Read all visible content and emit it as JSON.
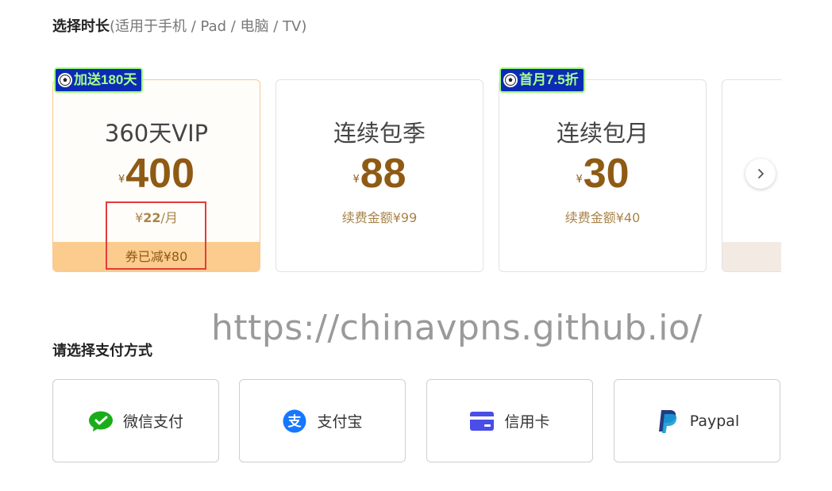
{
  "duration": {
    "title": "选择时长",
    "subtitle": "(适用于手机 / Pad / 电脑 / TV)"
  },
  "plans": [
    {
      "badge": "加送180天",
      "name": "360天VIP",
      "currency": "¥",
      "price": "400",
      "note_prefix": "¥",
      "note_value": "22",
      "note_suffix": "/月",
      "coupon": "券已减¥80",
      "selected": true
    },
    {
      "name": "连续包季",
      "currency": "¥",
      "price": "88",
      "note": "续费金额¥99",
      "selected": false
    },
    {
      "badge": "首月7.5折",
      "name": "连续包月",
      "currency": "¥",
      "price": "30",
      "note": "续费金额¥40",
      "selected": false
    }
  ],
  "payment": {
    "title": "请选择支付方式",
    "methods": [
      {
        "label": "微信支付",
        "icon": "wechat-pay-icon"
      },
      {
        "label": "支付宝",
        "icon": "alipay-icon"
      },
      {
        "label": "信用卡",
        "icon": "credit-card-icon"
      },
      {
        "label": "Paypal",
        "icon": "paypal-icon"
      }
    ]
  },
  "watermark": "https://chinavpns.github.io/",
  "colors": {
    "price": "#8f5a14",
    "coupon_bar": "#fccc8e",
    "badge_bg": "#0b2bb4",
    "badge_text": "#a7ff8a",
    "highlight": "#e23b3b",
    "wechat": "#1aad19",
    "alipay": "#1677ff",
    "card": "#4a4de6",
    "paypal_dark": "#253b80",
    "paypal_light": "#179bd7"
  }
}
